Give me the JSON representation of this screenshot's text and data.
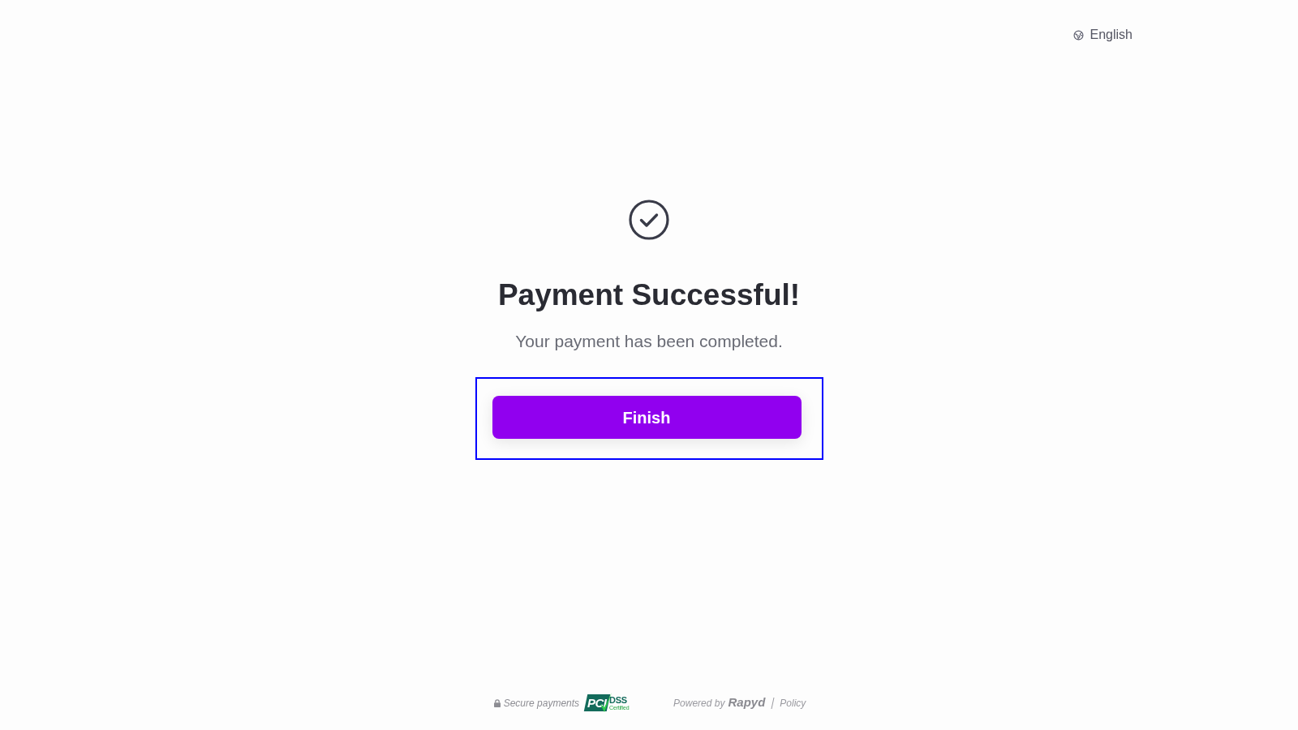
{
  "header": {
    "language": "English"
  },
  "status": {
    "kind": "success",
    "title": "Payment Successful!",
    "message": "Your payment has been completed."
  },
  "actions": {
    "focused": true,
    "buttons": [
      {
        "label": "Finish",
        "kind": "primary"
      }
    ]
  },
  "footer": {
    "secure_label": "Secure payments",
    "certification": {
      "mark": "PCI",
      "standard": "DSS",
      "status": "Certified"
    },
    "powered_by": "Powered by",
    "brand": "Rapyd",
    "links": [
      "Policy"
    ]
  }
}
